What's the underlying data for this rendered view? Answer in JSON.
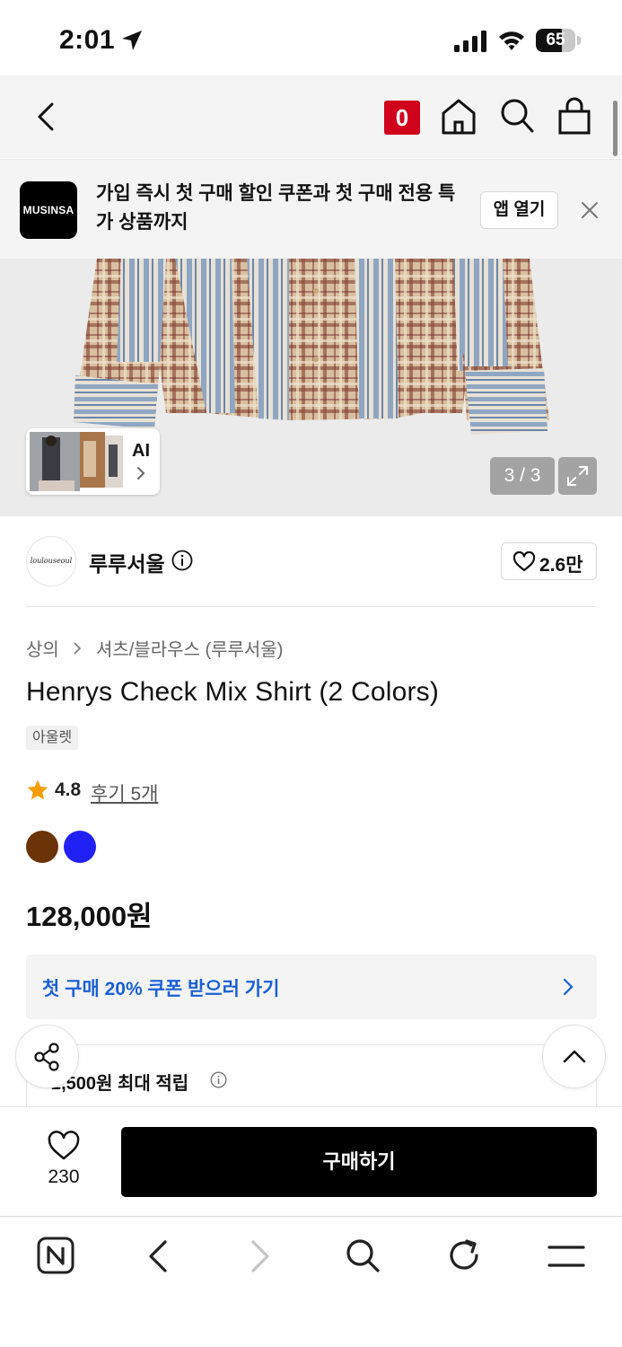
{
  "status_bar": {
    "time": "2:01",
    "battery": "65",
    "battery_level": 0.65
  },
  "nav": {
    "cart_count": "0"
  },
  "banner": {
    "logo_text": "MUSINSA",
    "message": "가입 즉시 첫 구매 할인 쿠폰과 첫 구매 전용 특가 상품까지",
    "open_app": "앱 열기"
  },
  "gallery": {
    "ai_label": "AI",
    "page_indicator": "3 / 3"
  },
  "brand": {
    "name": "루루서울",
    "logo_text": "loulouseoul",
    "likes": "2.6만"
  },
  "product": {
    "breadcrumb": [
      "상의",
      "셔츠/블라우스 (루루서울)"
    ],
    "title": "Henrys Check Mix Shirt (2 Colors)",
    "tag": "아울렛",
    "rating": "4.8",
    "reviews_link": "후기 5개",
    "colors": [
      "#6b3408",
      "#2121f5"
    ],
    "price": "128,000원"
  },
  "coupon": {
    "label": "첫 구매 20% 쿠폰 받으러 가기"
  },
  "points": {
    "label": "2,500원 최대 적립"
  },
  "buy_bar": {
    "wish_count": "230",
    "buy_label": "구매하기"
  },
  "icons": {
    "nav": [
      "back-icon",
      "home-icon",
      "search-icon",
      "bag-icon"
    ],
    "browser": [
      "naver-n-icon",
      "back-icon",
      "forward-icon",
      "search-icon",
      "reload-icon",
      "menu-icon"
    ]
  }
}
